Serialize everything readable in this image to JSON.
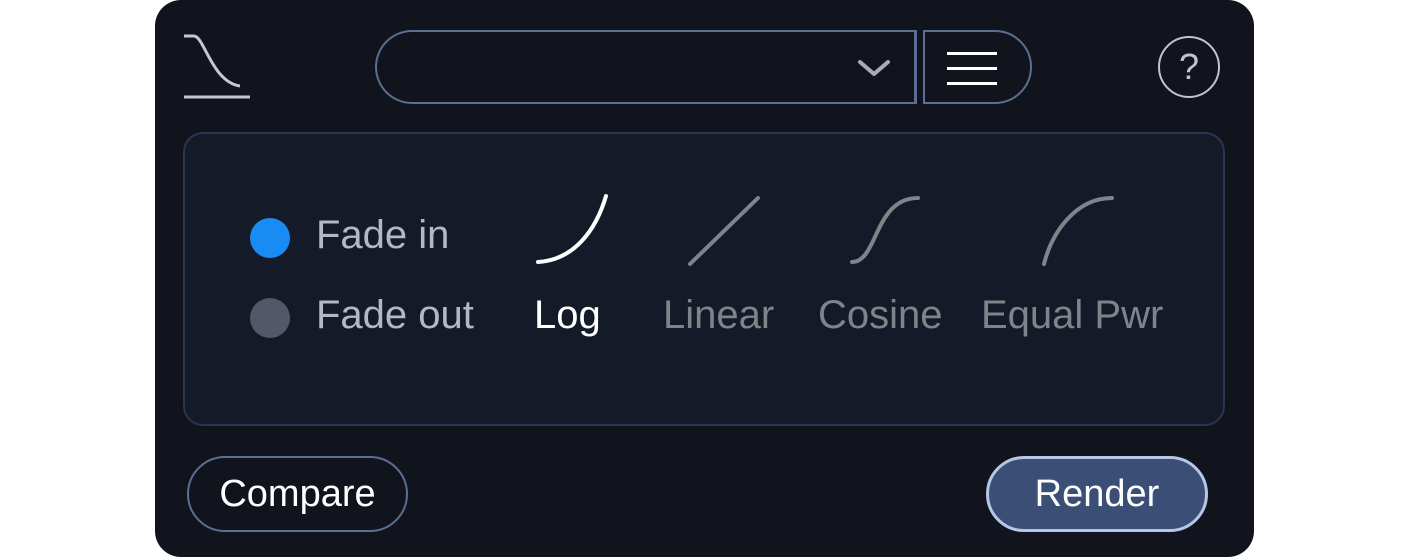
{
  "module": {
    "icon": "fade-curve-icon"
  },
  "header": {
    "preset_value": "",
    "preset_dropdown_icon": "chevron-down-icon",
    "menu_icon": "hamburger-menu-icon",
    "help_label": "?"
  },
  "fade_direction": {
    "options": [
      {
        "label": "Fade in",
        "selected": true
      },
      {
        "label": "Fade out",
        "selected": false
      }
    ],
    "selected_color": "#1a8bf2",
    "unselected_color": "#525868"
  },
  "curve_shapes": {
    "options": [
      {
        "label": "Log",
        "icon": "log-curve-icon",
        "selected": true
      },
      {
        "label": "Linear",
        "icon": "linear-curve-icon",
        "selected": false
      },
      {
        "label": "Cosine",
        "icon": "cosine-curve-icon",
        "selected": false
      },
      {
        "label": "Equal Pwr",
        "icon": "equal-power-curve-icon",
        "selected": false
      }
    ]
  },
  "footer": {
    "compare_label": "Compare",
    "render_label": "Render"
  },
  "colors": {
    "panel_bg": "#11141d",
    "border": "#5a6f93",
    "render_bg": "#3b4f76",
    "render_border": "#b5c6e6"
  }
}
